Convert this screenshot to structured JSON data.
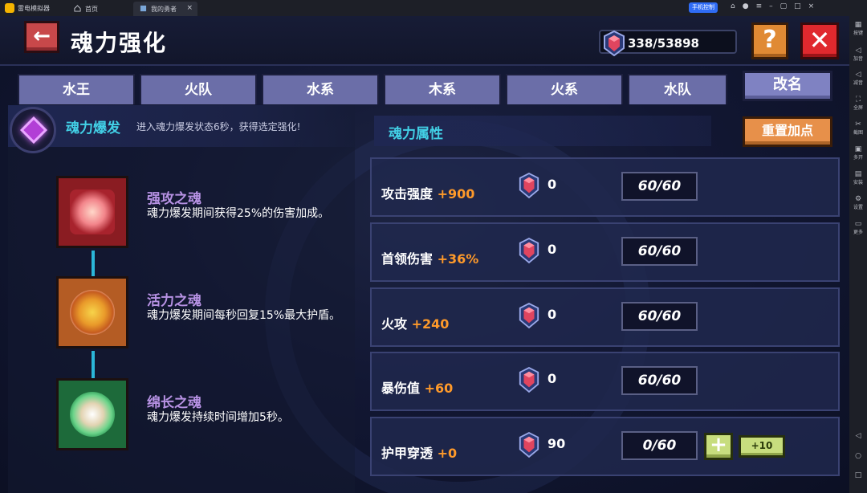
{
  "emulator": {
    "app_name": "雷电模拟器",
    "tabs": [
      {
        "label": "首页"
      },
      {
        "label": "我的勇者"
      }
    ],
    "phone_control": "手机控制",
    "sidebar": [
      {
        "icon": "keyboard-icon",
        "label": "按键"
      },
      {
        "icon": "volume-up-icon",
        "label": "加音"
      },
      {
        "icon": "volume-down-icon",
        "label": "减音"
      },
      {
        "icon": "fullscreen-icon",
        "label": "全屏"
      },
      {
        "icon": "screenshot-icon",
        "label": "截图"
      },
      {
        "icon": "multi-instance-icon",
        "label": "多开"
      },
      {
        "icon": "install-icon",
        "label": "安装"
      },
      {
        "icon": "settings-icon",
        "label": "设置"
      },
      {
        "icon": "more-icon",
        "label": "更多"
      }
    ]
  },
  "header": {
    "title": "魂力强化",
    "currency": "338/53898"
  },
  "tabs": [
    {
      "label": "水王"
    },
    {
      "label": "火队"
    },
    {
      "label": "水系"
    },
    {
      "label": "木系"
    },
    {
      "label": "火系"
    },
    {
      "label": "水队"
    }
  ],
  "rename_label": "改名",
  "burst": {
    "title": "魂力爆发",
    "description": "进入魂力爆发状态6秒，获得选定强化!"
  },
  "souls": [
    {
      "name": "强攻之魂",
      "description": "魂力爆发期间获得25%的伤害加成。"
    },
    {
      "name": "活力之魂",
      "description": "魂力爆发期间每秒回复15%最大护盾。"
    },
    {
      "name": "绵长之魂",
      "description": "魂力爆发持续时间增加5秒。"
    }
  ],
  "attributes_title": "魂力属性",
  "reset_label": "重置加点",
  "attributes": [
    {
      "name": "攻击强度",
      "bonus": "+900",
      "count": "0",
      "progress": "60/60"
    },
    {
      "name": "首领伤害",
      "bonus": "+36%",
      "count": "0",
      "progress": "60/60"
    },
    {
      "name": "火攻",
      "bonus": "+240",
      "count": "0",
      "progress": "60/60"
    },
    {
      "name": "暴伤值",
      "bonus": "+60",
      "count": "0",
      "progress": "60/60"
    },
    {
      "name": "护甲穿透",
      "bonus": "+0",
      "count": "90",
      "progress": "0/60"
    }
  ],
  "plus_label": "+",
  "plus10_label": "+10",
  "colors": {
    "accent_cyan": "#42d0e6",
    "bonus_orange": "#ff9a2a",
    "soul_name_purple": "#b792e4"
  }
}
